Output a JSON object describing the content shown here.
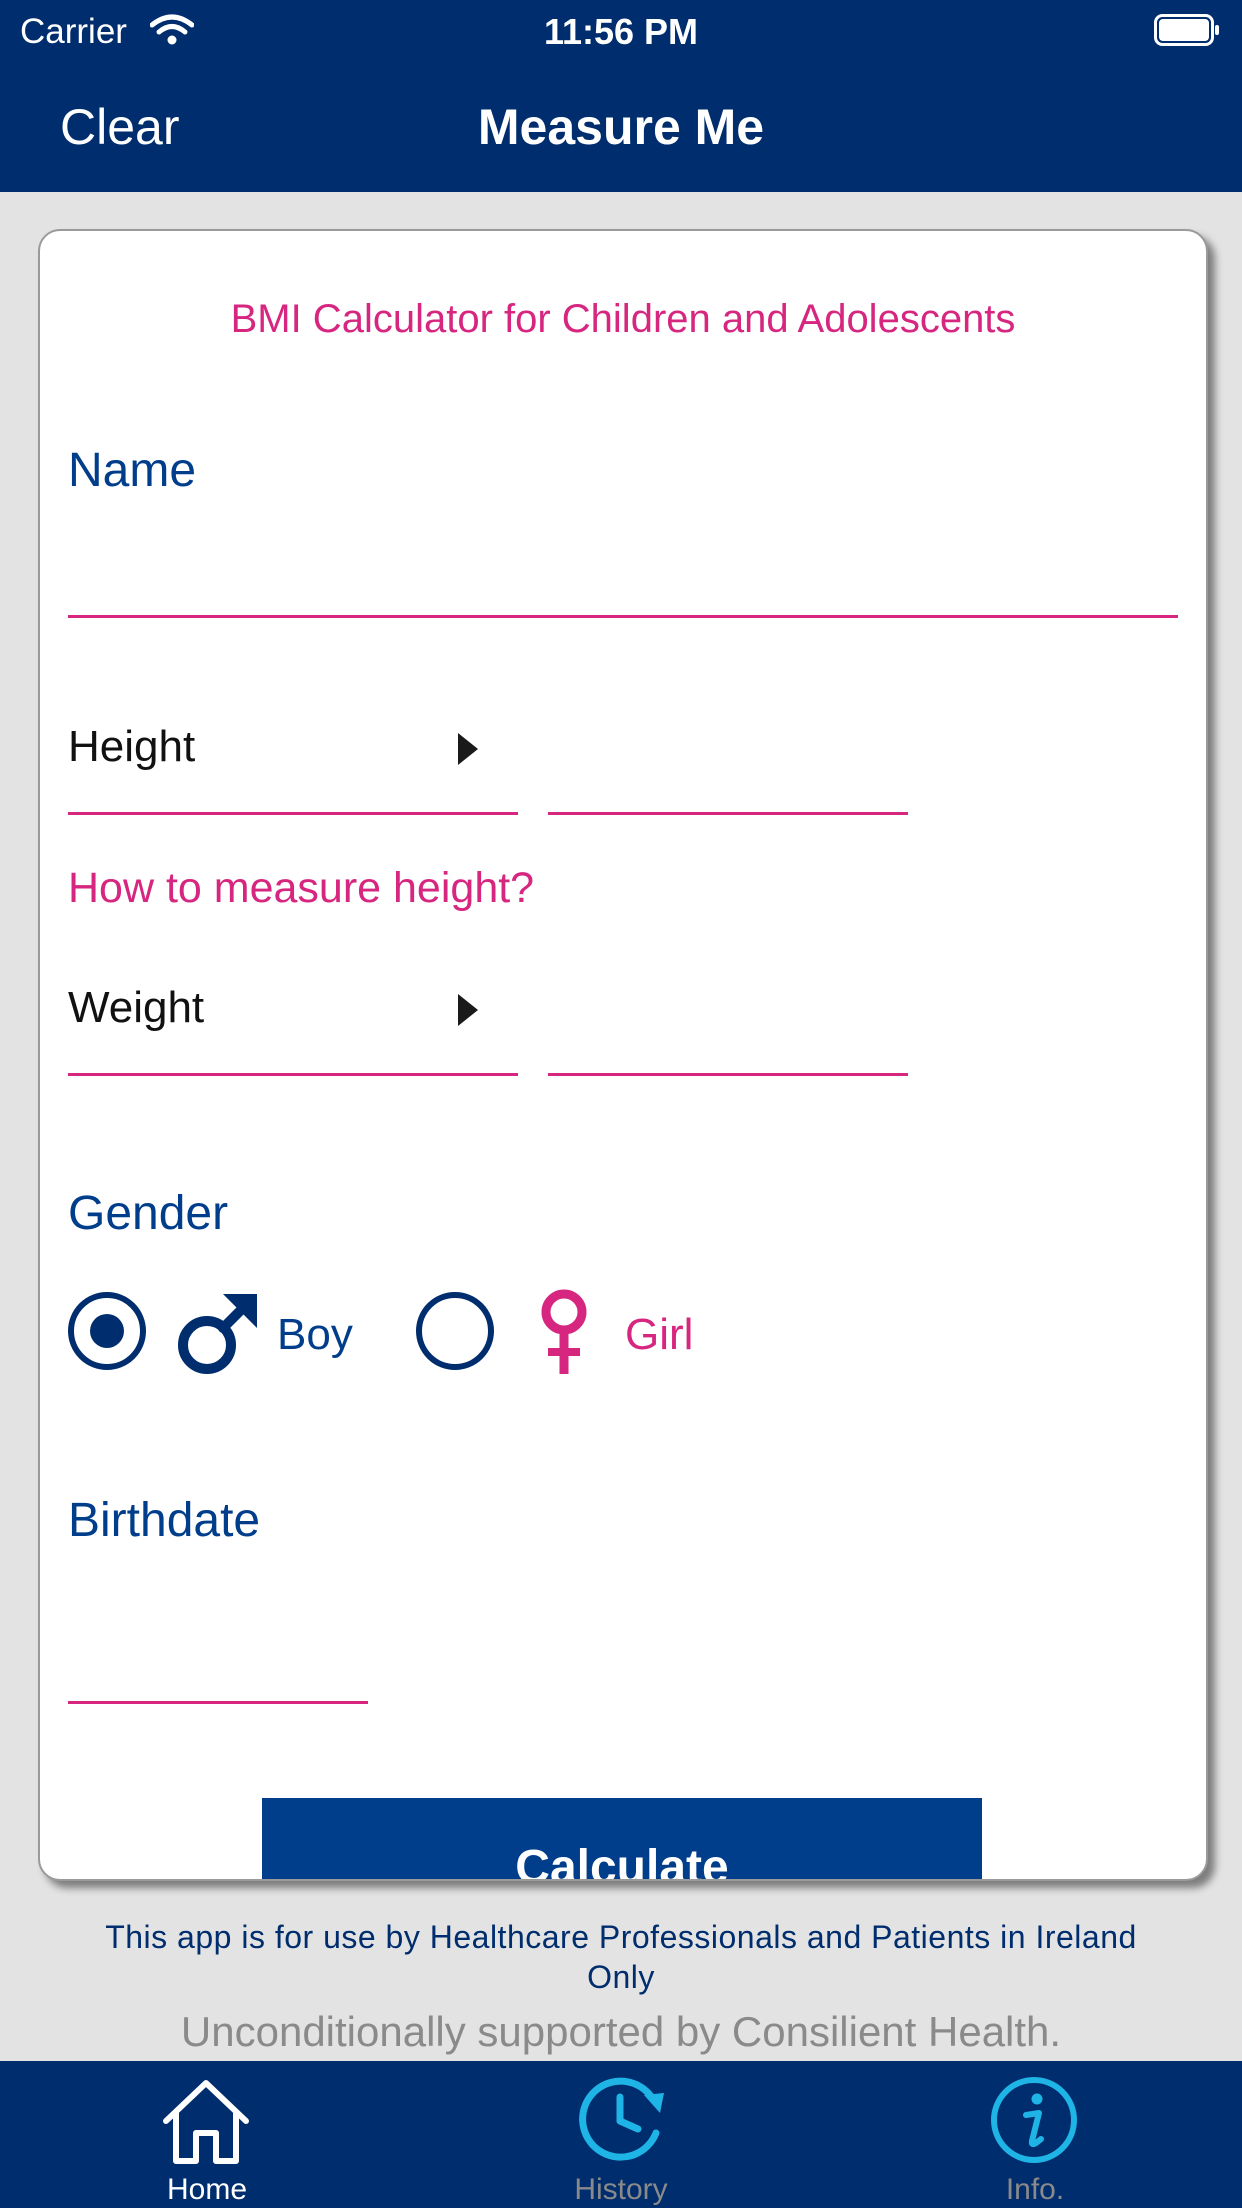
{
  "status_bar": {
    "carrier": "Carrier",
    "time": "11:56 PM"
  },
  "nav": {
    "clear_label": "Clear",
    "title": "Measure Me"
  },
  "form": {
    "title": "BMI Calculator for Children and Adolescents",
    "name_label": "Name",
    "name_value": "",
    "height_unit_label": "Height",
    "height_value": "",
    "height_help_link": "How to measure height?",
    "weight_unit_label": "Weight",
    "weight_value": "",
    "gender_label": "Gender",
    "gender_options": [
      {
        "label": "Boy",
        "selected": true,
        "icon": "male-symbol-icon"
      },
      {
        "label": "Girl",
        "selected": false,
        "icon": "female-symbol-icon"
      }
    ],
    "birthdate_label": "Birthdate",
    "birthdate_value": "",
    "calculate_button": "Calculate"
  },
  "footer": {
    "disclaimer": "This app is for use by Healthcare Professionals and Patients in Ireland Only",
    "sponsor": "Unconditionally supported by Consilient Health."
  },
  "tab_bar": {
    "tabs": [
      {
        "label": "Home",
        "icon": "home-icon",
        "active": true
      },
      {
        "label": "History",
        "icon": "history-clock-icon",
        "active": false
      },
      {
        "label": "Info.",
        "icon": "info-icon",
        "active": false
      }
    ]
  },
  "colors": {
    "nav_background": "#002d6e",
    "accent_pink": "#d6267f",
    "label_blue": "#003d8a",
    "tab_icon_cyan": "#1fb4e6",
    "inactive_tab_text": "#8a8a8a"
  }
}
